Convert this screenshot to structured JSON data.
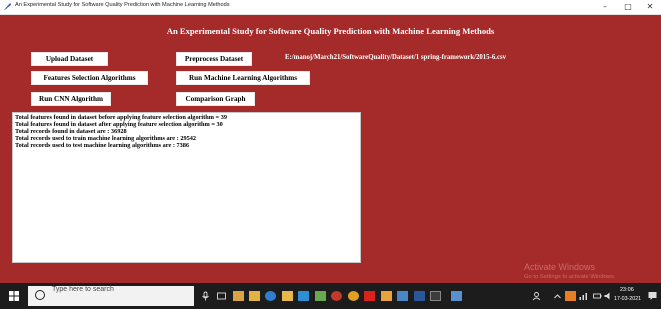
{
  "window": {
    "title": "An Experimental Study for Software Quality Prediction with Machine Learning Methods",
    "minimize_glyph": "–",
    "maximize_glyph": "□",
    "close_glyph": "✕"
  },
  "app": {
    "heading": "An Experimental Study for Software Quality Prediction with Machine Learning Methods",
    "dataset_path": "E:/manoj/March21/SoftwareQuality/Dataset/1 spring-framework/2015-6.csv",
    "buttons": {
      "upload": "Upload Dataset",
      "preprocess": "Preprocess Dataset",
      "features": "Features Selection Algorithms",
      "run_ml": "Run Machine Learning Algorithms",
      "run_cnn": "Run CNN Algorithm",
      "comparison": "Comparison Graph"
    },
    "output_lines": [
      "Total features found in dataset before applying feature selection algorithm = 39",
      "Total features found in dataset after applying feature selection algorithm  = 30",
      "Total records found in dataset are : 36928",
      "Total records used to train machine learning algorithms are : 29542",
      "Total records used to test machine learning algorithms are  : 7386"
    ],
    "colors": {
      "background": "#a52a2a",
      "text": "#ffffff"
    }
  },
  "watermark": {
    "title": "Activate Windows",
    "subtitle": "Go to Settings to activate Windows."
  },
  "taskbar": {
    "search_placeholder": "Type here to search",
    "clock_time": "23:06",
    "clock_date": "17-03-2021",
    "pinned_icons": [
      "task-view-icon",
      "store-icon",
      "file-explorer-icon",
      "edge-icon",
      "folder-icon",
      "photos-icon",
      "media-icon",
      "chrome-icon",
      "acrobat-icon",
      "paint-icon",
      "python-icon",
      "word-icon",
      "cmd-icon",
      "app-icon"
    ]
  }
}
